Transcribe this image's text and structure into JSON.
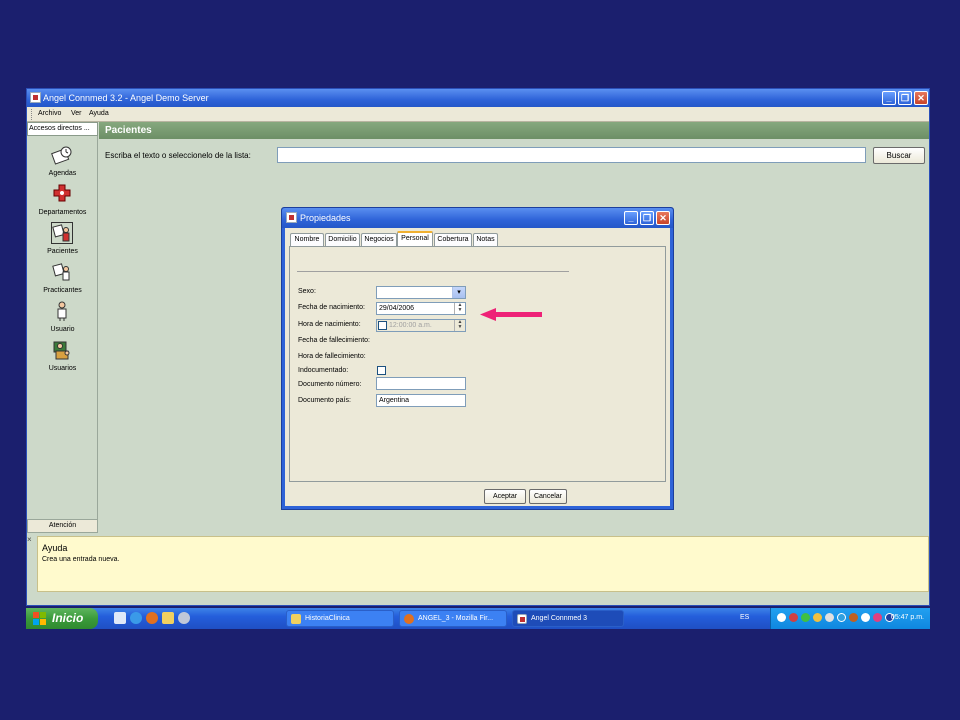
{
  "window": {
    "title": "Angel Connmed 3.2 - Angel Demo Server",
    "minimize": "_",
    "restore": "❐",
    "close": "✕"
  },
  "menu": {
    "archivo": "Archivo",
    "ver": "Ver",
    "ayuda": "Ayuda"
  },
  "sidebar": {
    "header": "Accesos directos ...",
    "items": [
      {
        "label": "Agendas",
        "icon": "agenda-icon"
      },
      {
        "label": "Departamentos",
        "icon": "departments-icon"
      },
      {
        "label": "Pacientes",
        "icon": "patients-icon"
      },
      {
        "label": "Practicantes",
        "icon": "practitioners-icon"
      },
      {
        "label": "Usuario",
        "icon": "user-icon"
      },
      {
        "label": "Usuarios",
        "icon": "users-icon"
      }
    ],
    "footer": "Atención"
  },
  "content": {
    "heading": "Pacientes",
    "search_label": "Escriba el texto o seleccionelo de la lista:",
    "search_value": "",
    "search_button": "Buscar"
  },
  "help": {
    "title": "Ayuda",
    "text": "Crea una entrada nueva.",
    "close": "×"
  },
  "dialog": {
    "title": "Propiedades",
    "tabs": [
      "Nombre",
      "Domicilio",
      "Negocios",
      "Personal",
      "Cobertura",
      "Notas"
    ],
    "selected_tab": "Personal",
    "fields": {
      "sexo_label": "Sexo:",
      "sexo_value": "",
      "fecha_nac_label": "Fecha de nacimiento:",
      "fecha_nac_value": "29/04/2006",
      "hora_nac_label": "Hora de nacimiento:",
      "hora_nac_value": "12:00:00 a.m.",
      "fecha_fall_label": "Fecha de fallecimiento:",
      "hora_fall_label": "Hora de fallecimiento:",
      "indocumentado_label": "Indocumentado:",
      "doc_numero_label": "Documento número:",
      "doc_numero_value": "",
      "doc_pais_label": "Documento país:",
      "doc_pais_value": "Argentina"
    },
    "ok_button": "Aceptar",
    "cancel_button": "Cancelar"
  },
  "taskbar": {
    "start": "Inicio",
    "tasks": [
      "HistoriaClinica",
      "ANGEL_3 - Mozilla Fir...",
      "Angel Connmed 3"
    ],
    "active_task": "Angel Connmed 3",
    "lang": "ES",
    "clock": "05:47 p.m."
  },
  "colors": {
    "background": "#1b1f6e",
    "titlebar": "#2e63d8",
    "panel": "#cdd9c9",
    "help_bg": "#fffacd",
    "arrow": "#ee2277"
  }
}
